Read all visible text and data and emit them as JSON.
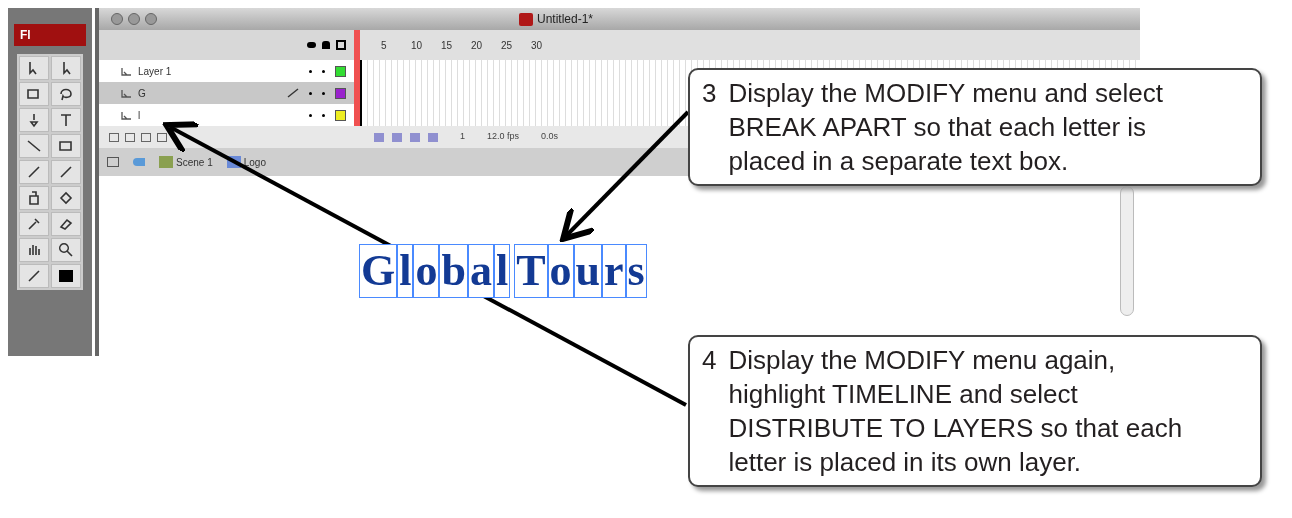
{
  "toolbar": {
    "logo": "Fl"
  },
  "window": {
    "title": "Untitled-1*"
  },
  "timeline": {
    "ruler": [
      "5",
      "10",
      "15",
      "20",
      "25",
      "30"
    ],
    "layers": [
      {
        "name": "Layer 1",
        "selected": false,
        "editing": false,
        "color": "#33dd33"
      },
      {
        "name": "G",
        "selected": true,
        "editing": true,
        "color": "#9922cc"
      },
      {
        "name": "l",
        "selected": false,
        "editing": false,
        "color": "#eeee22"
      }
    ],
    "status": [
      "1",
      "12.0 fps",
      "0.0s"
    ]
  },
  "breadcrumb": [
    "Scene 1",
    "Logo"
  ],
  "stage": {
    "words": [
      "Global",
      "Tours"
    ]
  },
  "callouts": [
    {
      "number": "3",
      "text": "Display the MODIFY menu and select BREAK APART so that each letter is placed in a separate text box."
    },
    {
      "number": "4",
      "text": "Display the MODIFY menu again, highlight TIMELINE and select DISTRIBUTE TO LAYERS so that each letter is placed in its own layer."
    }
  ]
}
